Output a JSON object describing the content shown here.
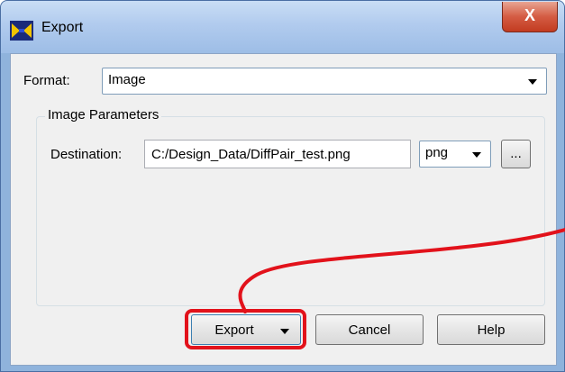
{
  "window": {
    "title": "Export",
    "close_label": "X",
    "colors": {
      "highlight": "#e2121b",
      "close": "#c23b21",
      "titlebar": "#b1cbee"
    }
  },
  "format": {
    "label": "Format:",
    "selected": "Image"
  },
  "image_params": {
    "group_title": "Image Parameters",
    "destination_label": "Destination:",
    "destination_value": "C:/Design_Data/DiffPair_test.png",
    "file_type": "png",
    "browse_label": "..."
  },
  "buttons": {
    "export": "Export",
    "cancel": "Cancel",
    "help": "Help"
  },
  "icons": {
    "app": "app-logo-icon",
    "close": "close-icon",
    "dropdown": "chevron-down-icon"
  }
}
